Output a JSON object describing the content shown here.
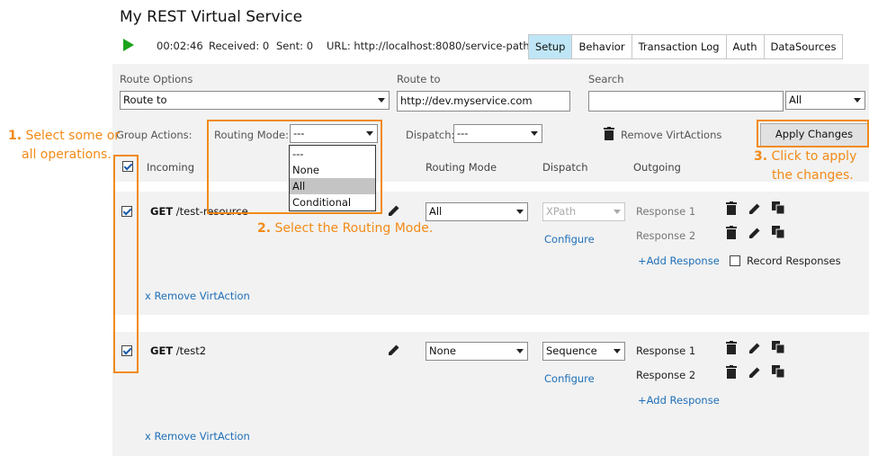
{
  "header": {
    "title": "My REST Virtual Service",
    "elapsed": "00:02:46",
    "received": "Received: 0",
    "sent": "Sent: 0",
    "url": "URL: http://localhost:8080/service-path"
  },
  "tabs": [
    {
      "label": "Setup",
      "active": true
    },
    {
      "label": "Behavior",
      "active": false
    },
    {
      "label": "Transaction Log",
      "active": false
    },
    {
      "label": "Auth",
      "active": false
    },
    {
      "label": "DataSources",
      "active": false
    }
  ],
  "route": {
    "options_label": "Route Options",
    "options_value": "Route to",
    "to_label": "Route to",
    "to_value": "http://dev.myservice.com",
    "search_label": "Search",
    "search_value": "",
    "search_scope": "All"
  },
  "group_actions": {
    "label": "Group Actions:",
    "routing_mode_label": "Routing Mode:",
    "routing_mode_value": "---",
    "routing_mode_options": [
      "---",
      "None",
      "All",
      "Conditional"
    ],
    "routing_mode_highlighted": "All",
    "dispatch_label": "Dispatch:",
    "dispatch_value": "---",
    "remove_label": "Remove VirtActions",
    "apply_label": "Apply Changes"
  },
  "columns": {
    "incoming": "Incoming",
    "routing_mode": "Routing Mode",
    "dispatch": "Dispatch",
    "outgoing": "Outgoing"
  },
  "rows": [
    {
      "method": "GET",
      "path": "/test-resource",
      "checked": true,
      "routing_mode": "All",
      "dispatch": "XPath",
      "dispatch_disabled": true,
      "configure": "Configure",
      "responses": [
        "Response 1",
        "Response 2"
      ],
      "responses_dim": true,
      "add_response": "+Add Response",
      "record_label": "Record Responses",
      "record_checked": false,
      "remove": "x Remove VirtAction"
    },
    {
      "method": "GET",
      "path": "/test2",
      "checked": true,
      "routing_mode": "None",
      "dispatch": "Sequence",
      "dispatch_disabled": false,
      "configure": "Configure",
      "responses": [
        "Response 1",
        "Response 2"
      ],
      "responses_dim": false,
      "add_response": "+Add Response",
      "remove": "x Remove VirtAction"
    }
  ],
  "annotations": {
    "step1_num": "1.",
    "step1_line1": "Select some or",
    "step1_line2": "all operations.",
    "step2_num": "2.",
    "step2_text": "Select the Routing Mode.",
    "step3_num": "3.",
    "step3_line1": "Click to apply",
    "step3_line2": "the changes."
  },
  "colors": {
    "accent": "#f28a17",
    "active_tab": "#bfe6f6",
    "link": "#1f6fb7",
    "play": "#1aa31a"
  }
}
